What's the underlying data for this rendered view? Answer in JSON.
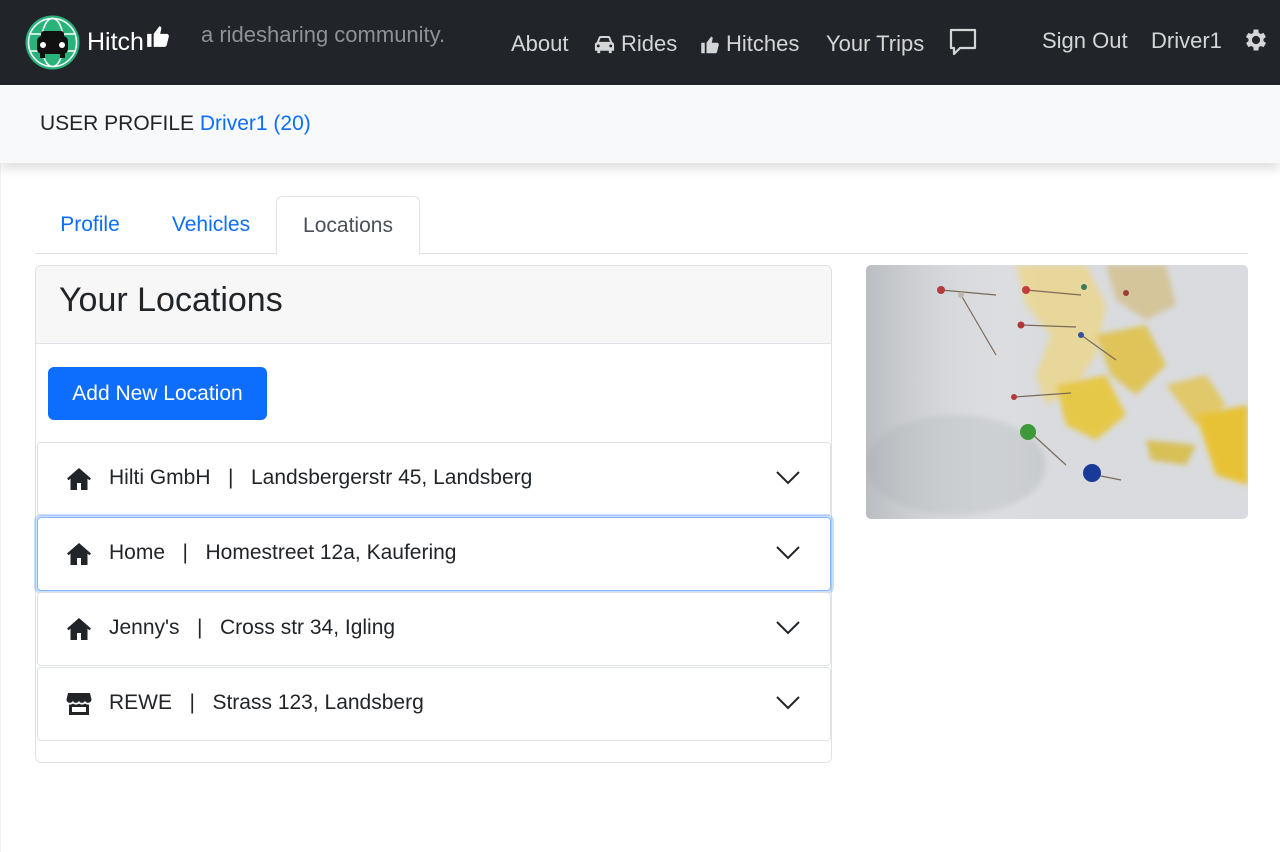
{
  "brand": {
    "name": "Hitch",
    "tagline": "a ridesharing community."
  },
  "nav": {
    "about": "About",
    "rides": "Rides",
    "hitches": "Hitches",
    "trips": "Your Trips",
    "sign_out": "Sign Out",
    "username": "Driver1",
    "icons": [
      "car-icon",
      "thumbs-up-icon",
      "chat-icon",
      "gear-icon"
    ]
  },
  "profile": {
    "label": "USER PROFILE",
    "user": "Driver1 (20)"
  },
  "tabs": [
    {
      "label": "Profile",
      "active": false
    },
    {
      "label": "Vehicles",
      "active": false
    },
    {
      "label": "Locations",
      "active": true
    }
  ],
  "locations_card": {
    "title": "Your Locations",
    "add_button": "Add New Location",
    "items": [
      {
        "name": "Hilti GmbH",
        "address": "Landsbergerstr 45, Landsberg",
        "icon": "home-icon",
        "active": false
      },
      {
        "name": "Home",
        "address": "Homestreet 12a, Kaufering",
        "icon": "home-icon",
        "active": true
      },
      {
        "name": "Jenny's",
        "address": "Cross str 34, Igling",
        "icon": "home-icon",
        "active": false
      },
      {
        "name": "REWE",
        "address": "Strass 123, Landsberg",
        "icon": "store-icon",
        "active": false
      }
    ]
  },
  "colors": {
    "navbar": "#212529",
    "accent": "#0d6efd",
    "brand_green": "#2ab27b"
  }
}
